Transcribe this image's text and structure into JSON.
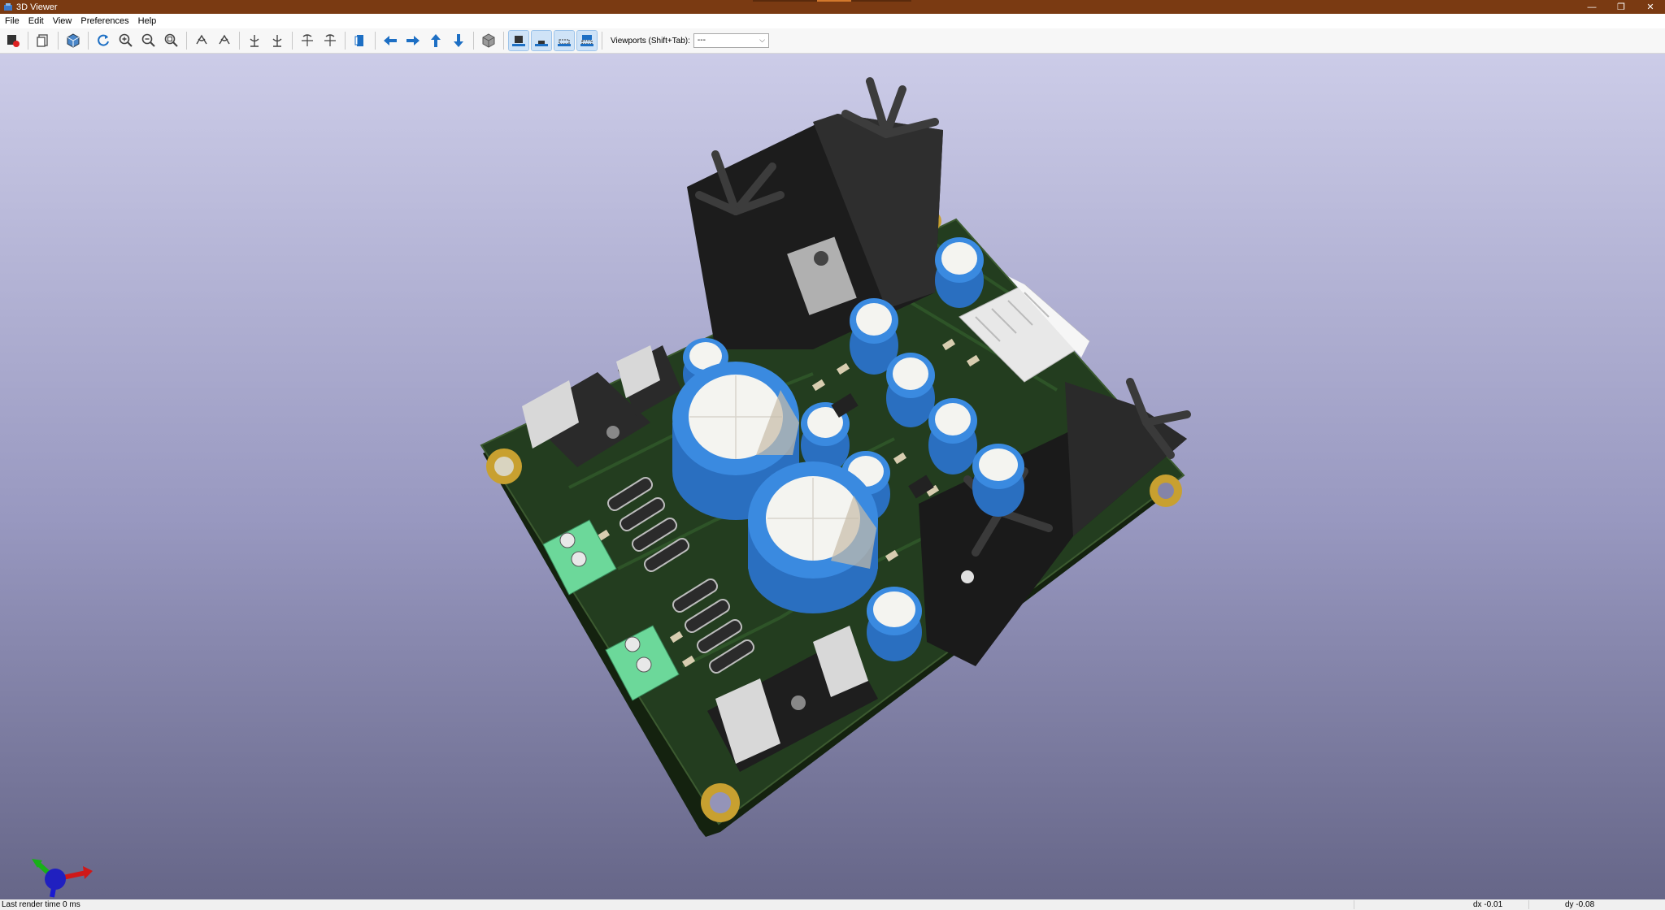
{
  "window": {
    "title": "3D Viewer",
    "minimize_glyph": "—",
    "restore_glyph": "❐",
    "close_glyph": "✕"
  },
  "menu": {
    "items": [
      {
        "label": "File"
      },
      {
        "label": "Edit"
      },
      {
        "label": "View"
      },
      {
        "label": "Preferences"
      },
      {
        "label": "Help"
      }
    ]
  },
  "toolbar": {
    "buttons": [
      {
        "icon": "render-raytracing-icon"
      },
      {
        "icon": "copy-image-icon"
      },
      {
        "icon": "display-options-icon"
      },
      {
        "icon": "reload-icon"
      },
      {
        "icon": "zoom-in-icon"
      },
      {
        "icon": "zoom-out-icon"
      },
      {
        "icon": "zoom-fit-icon"
      },
      {
        "icon": "rotate-x-cw-icon"
      },
      {
        "icon": "rotate-x-ccw-icon"
      },
      {
        "icon": "rotate-y-cw-icon"
      },
      {
        "icon": "rotate-y-ccw-icon"
      },
      {
        "icon": "rotate-z-cw-icon"
      },
      {
        "icon": "rotate-z-ccw-icon"
      },
      {
        "icon": "flip-board-icon"
      },
      {
        "icon": "pan-left-icon"
      },
      {
        "icon": "pan-right-icon"
      },
      {
        "icon": "pan-up-icon"
      },
      {
        "icon": "pan-down-icon"
      },
      {
        "icon": "ortho-toggle-icon"
      },
      {
        "icon": "show-tht-icon"
      },
      {
        "icon": "show-smd-icon"
      },
      {
        "icon": "show-virtual-icon"
      },
      {
        "icon": "show-not-in-posfile-icon"
      }
    ],
    "viewports_label": "Viewports (Shift+Tab):",
    "viewports_value": "---"
  },
  "status": {
    "render_time": "Last render time 0 ms",
    "dx": "dx -0.01",
    "dy": "dy -0.08"
  },
  "colors": {
    "title_bar": "#7a3a12",
    "pcb_mask": "#1e3a1c",
    "capacitor_blue": "#3a8ae0",
    "capacitor_top": "#f4f4f0",
    "pad_gold": "#c8a030",
    "heatsink": "#2a2a2a",
    "terminal_green": "#6cd89a"
  }
}
